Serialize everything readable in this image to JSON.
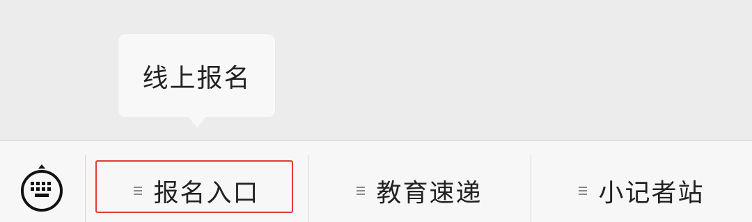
{
  "submenu": {
    "items": [
      {
        "label": "线上报名"
      }
    ]
  },
  "menubar": {
    "keyboard_icon": "keyboard-icon",
    "menus": [
      {
        "label": "报名入口",
        "icon": "menu-list-icon",
        "highlighted": true
      },
      {
        "label": "教育速递",
        "icon": "menu-list-icon"
      },
      {
        "label": "小记者站",
        "icon": "menu-list-icon"
      }
    ]
  },
  "colors": {
    "highlight": "#e53935",
    "background": "#ececec",
    "menubar": "#f7f7f7"
  }
}
